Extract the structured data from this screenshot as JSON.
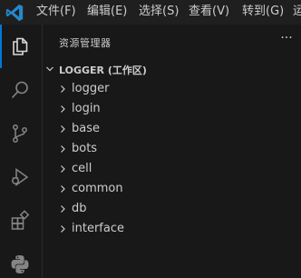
{
  "menubar": {
    "items": [
      "文件(F)",
      "编辑(E)",
      "选择(S)",
      "查看(V)",
      "转到(G)",
      "运"
    ]
  },
  "activitybar": {
    "items": [
      {
        "icon": "explorer-icon",
        "active": true
      },
      {
        "icon": "search-icon",
        "active": false
      },
      {
        "icon": "source-control-icon",
        "active": false
      },
      {
        "icon": "run-debug-icon",
        "active": false
      },
      {
        "icon": "extensions-icon",
        "active": false
      },
      {
        "icon": "python-icon",
        "active": false
      }
    ]
  },
  "sidebar": {
    "title": "资源管理器",
    "more": "···",
    "workspace": "LOGGER (工作区)",
    "folders": [
      "logger",
      "login",
      "base",
      "bots",
      "cell",
      "common",
      "db",
      "interface"
    ]
  },
  "colors": {
    "accent": "#0078d4",
    "vscode_blue": "#2489ca",
    "background": "#181818",
    "text": "#cccccc"
  }
}
